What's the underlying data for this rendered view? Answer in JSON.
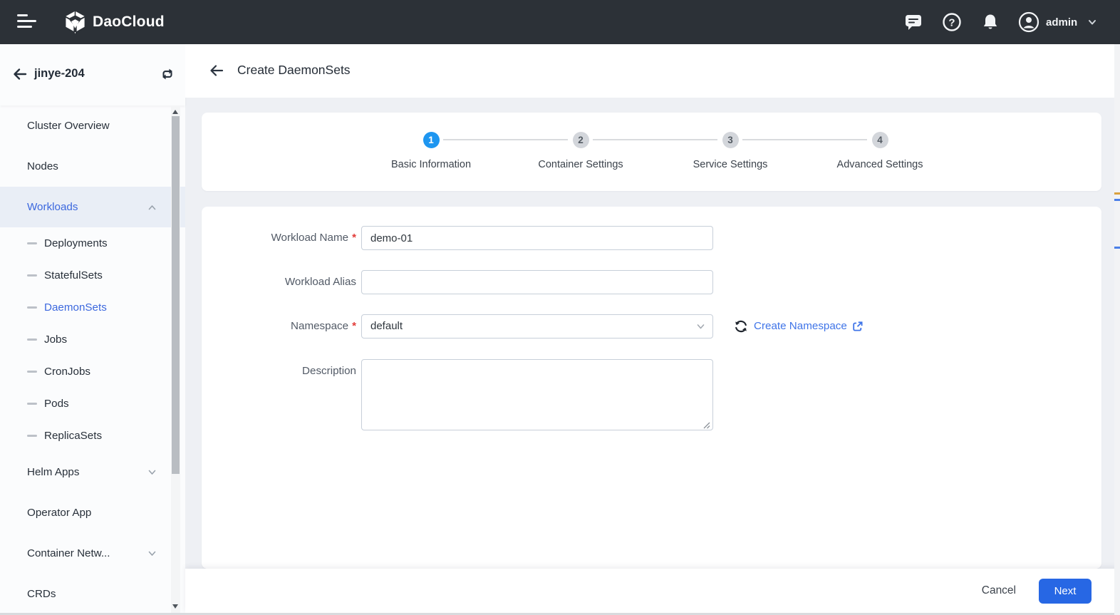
{
  "colors": {
    "topbar_bg": "#2c3137",
    "accent_step": "#1e96f0",
    "primary_button": "#2767e4",
    "link": "#3f74e8",
    "active_nav": "#3c68de"
  },
  "topbar": {
    "brand": "DaoCloud",
    "user_label": "admin"
  },
  "sidebar": {
    "cluster_name": "jinye-204",
    "items": [
      {
        "label": "Cluster Overview",
        "type": "top"
      },
      {
        "label": "Nodes",
        "type": "top"
      },
      {
        "label": "Workloads",
        "type": "top",
        "active": true,
        "chevron": "up"
      },
      {
        "label": "Deployments",
        "type": "sub"
      },
      {
        "label": "StatefulSets",
        "type": "sub"
      },
      {
        "label": "DaemonSets",
        "type": "sub",
        "active": true
      },
      {
        "label": "Jobs",
        "type": "sub"
      },
      {
        "label": "CronJobs",
        "type": "sub"
      },
      {
        "label": "Pods",
        "type": "sub"
      },
      {
        "label": "ReplicaSets",
        "type": "sub"
      },
      {
        "label": "Helm Apps",
        "type": "top",
        "chevron": "down"
      },
      {
        "label": "Operator App",
        "type": "top"
      },
      {
        "label": "Container Netw...",
        "type": "top",
        "chevron": "down"
      },
      {
        "label": "CRDs",
        "type": "top"
      }
    ]
  },
  "page": {
    "title": "Create DaemonSets"
  },
  "stepper": {
    "steps": [
      {
        "num": "1",
        "label": "Basic Information",
        "active": true
      },
      {
        "num": "2",
        "label": "Container Settings",
        "active": false
      },
      {
        "num": "3",
        "label": "Service Settings",
        "active": false
      },
      {
        "num": "4",
        "label": "Advanced Settings",
        "active": false
      }
    ]
  },
  "form": {
    "workload_name": {
      "label": "Workload Name",
      "required": true,
      "value": "demo-01"
    },
    "workload_alias": {
      "label": "Workload Alias",
      "required": false,
      "value": ""
    },
    "namespace": {
      "label": "Namespace",
      "required": true,
      "value": "default",
      "link_label": "Create Namespace"
    },
    "description": {
      "label": "Description",
      "required": false,
      "value": ""
    }
  },
  "footer": {
    "cancel_label": "Cancel",
    "next_label": "Next"
  }
}
